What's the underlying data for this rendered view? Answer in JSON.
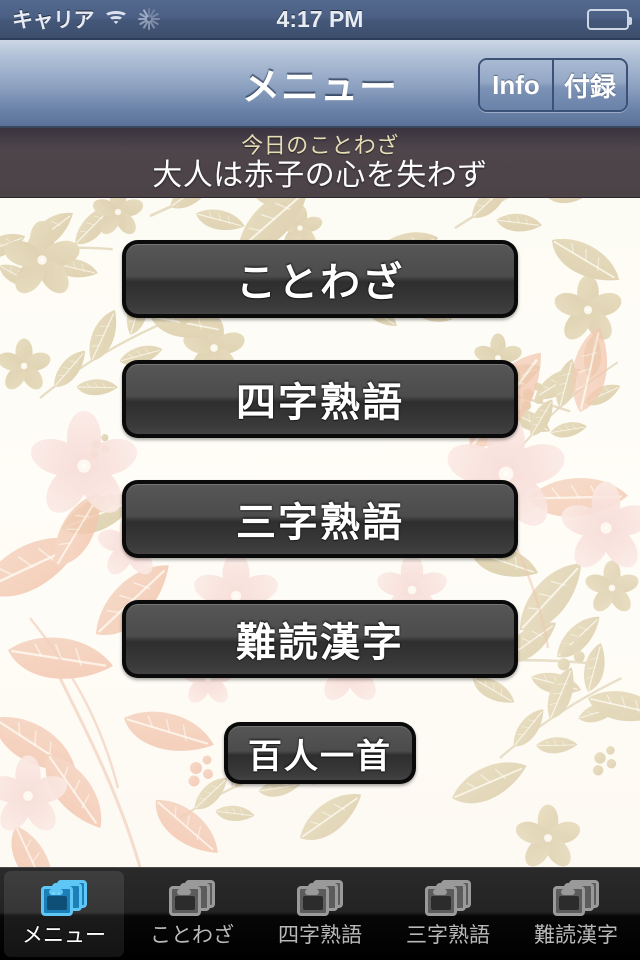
{
  "status_bar": {
    "carrier": "キャリア",
    "time": "4:17 PM",
    "wifi_icon": "wifi-icon",
    "activity_icon": "network-activity-spinner-icon",
    "battery_icon": "battery-icon"
  },
  "nav_bar": {
    "title": "メニュー",
    "segments": [
      {
        "label": "Info"
      },
      {
        "label": "付録"
      }
    ]
  },
  "banner": {
    "label": "今日のことわざ",
    "text": "大人は赤子の心を失わず",
    "label_color": "#e6dcb6",
    "text_color": "#fdfdfd",
    "background_color": "#4c4347"
  },
  "menu": {
    "buttons": [
      {
        "label": "ことわざ"
      },
      {
        "label": "四字熟語"
      },
      {
        "label": "三字熟語"
      },
      {
        "label": "難読漢字"
      },
      {
        "label": "百人一首"
      }
    ]
  },
  "tab_bar": {
    "tabs": [
      {
        "label": "メニュー",
        "icon": "stacked-windows-icon",
        "active": true
      },
      {
        "label": "ことわざ",
        "icon": "stacked-windows-icon",
        "active": false
      },
      {
        "label": "四字熟語",
        "icon": "stacked-windows-icon",
        "active": false
      },
      {
        "label": "三字熟語",
        "icon": "stacked-windows-icon",
        "active": false
      },
      {
        "label": "難読漢字",
        "icon": "stacked-windows-icon",
        "active": false
      }
    ],
    "active_tint": "#5fc7f5",
    "inactive_tint": "#9a9a9a"
  }
}
